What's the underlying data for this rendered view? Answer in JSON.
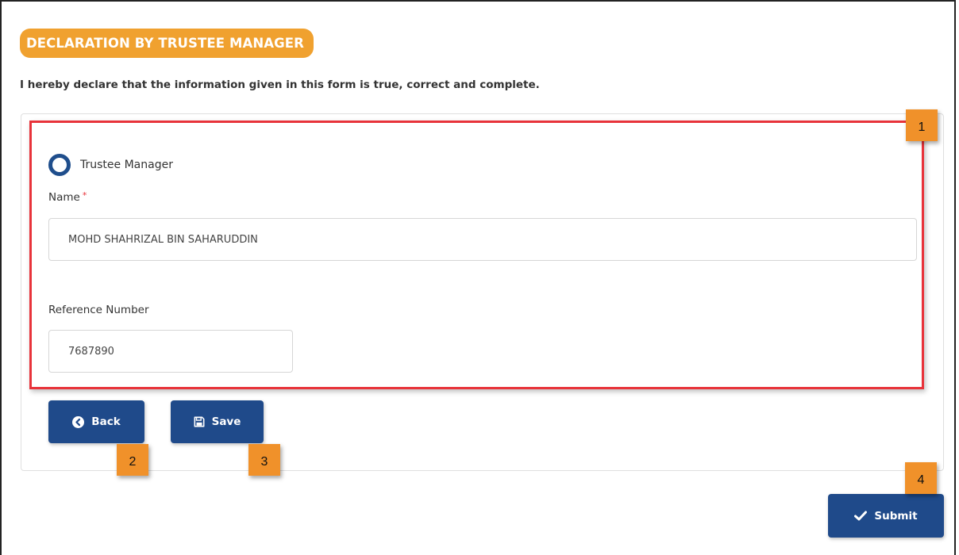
{
  "section": {
    "title": "DECLARATION BY TRUSTEE MANAGER"
  },
  "declaration_text": "I hereby declare that the information given in this form is true, correct and complete.",
  "form": {
    "role_option": {
      "label": "Trustee Manager",
      "selected": false
    },
    "name": {
      "label": "Name",
      "required_mark": "*",
      "value": "MOHD SHAHRIZAL BIN SAHARUDDIN"
    },
    "reference": {
      "label": "Reference Number",
      "value": "7687890"
    }
  },
  "buttons": {
    "back": "Back",
    "save": "Save",
    "submit": "Submit"
  },
  "annotations": {
    "m1": "1",
    "m2": "2",
    "m3": "3",
    "m4": "4"
  },
  "icons": {
    "radio": "radio-icon",
    "back": "chevron-left-circle-icon",
    "save": "floppy-disk-icon",
    "submit": "checkmark-icon"
  },
  "colors": {
    "badge": "#f0a12f",
    "primary": "#1f4a8a",
    "highlight": "#e8333a",
    "marker": "#f0912a",
    "required": "#e8333a"
  }
}
